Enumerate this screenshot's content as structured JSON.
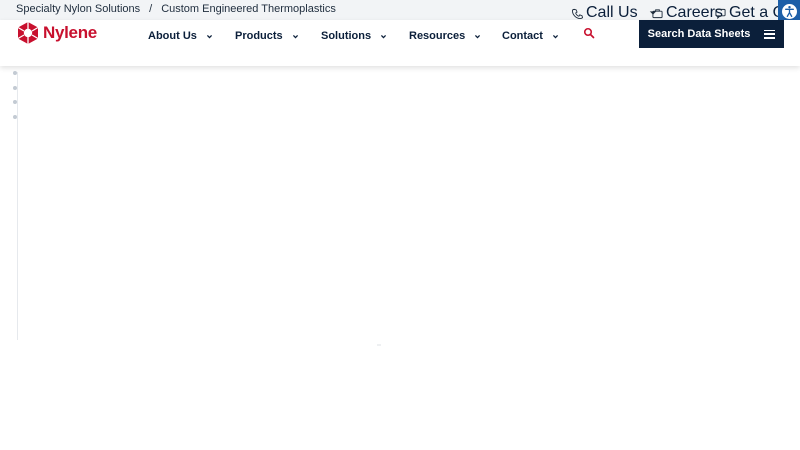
{
  "topbar": {
    "crumb_1": "Specialty Nylon Solutions",
    "separator": "/",
    "crumb_2": "Custom Engineered Thermoplastics",
    "call_us": "Call Us",
    "careers": "Careers",
    "get_quote": "Get a Quote",
    "icons": {
      "call": "phone-icon",
      "careers": "briefcase-icon",
      "quote": "quote-icon",
      "accessibility": "accessibility-icon"
    }
  },
  "header": {
    "logo_text": "Nylene",
    "nav": [
      {
        "label": "About Us"
      },
      {
        "label": "Products"
      },
      {
        "label": "Solutions"
      },
      {
        "label": "Resources"
      },
      {
        "label": "Contact"
      }
    ],
    "cta_label": "Search Data Sheets"
  },
  "colors": {
    "brand_red": "#c8102e",
    "navy": "#0b1f3a",
    "topbar_bg": "#f2f4f6",
    "accessibility_blue": "#1d5fa8"
  }
}
